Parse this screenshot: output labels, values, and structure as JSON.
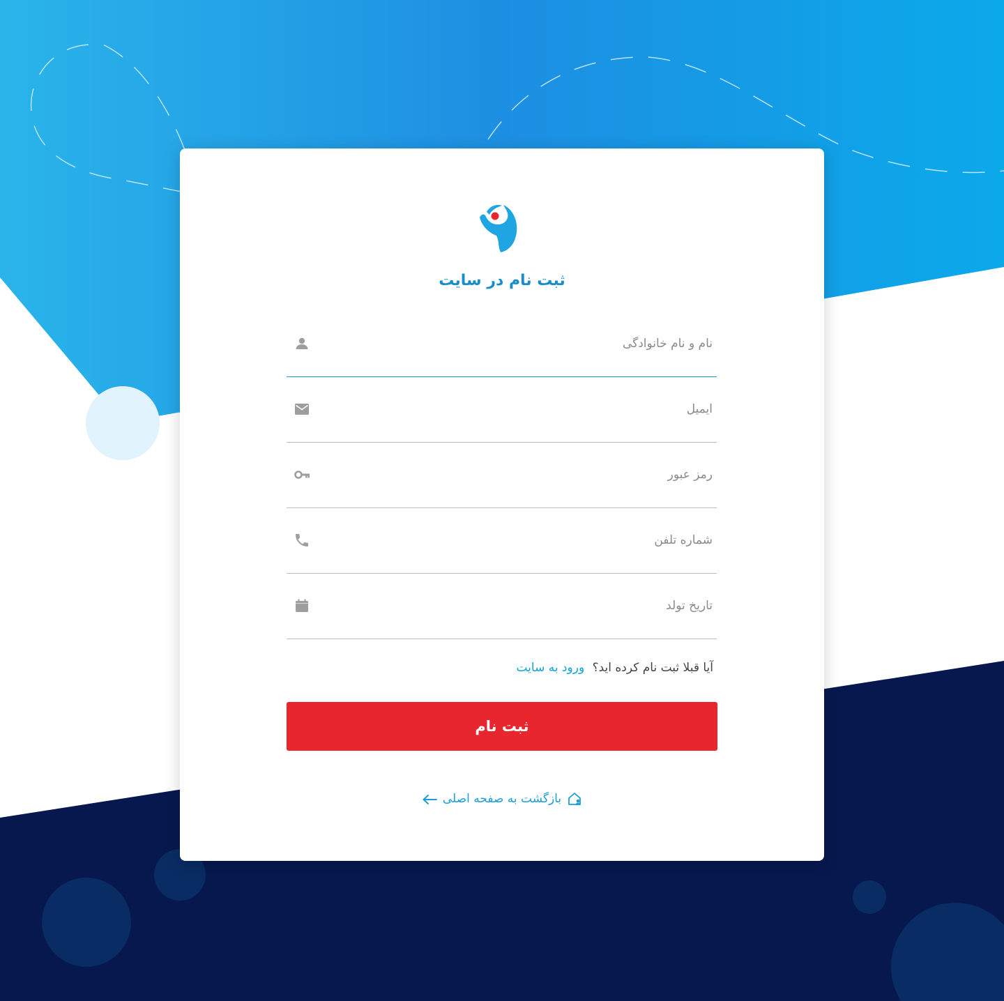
{
  "colors": {
    "sky_top": "#1d95e4",
    "sky_light": "#2ab4ea",
    "navy": "#06184d",
    "accent_blue": "#1a8cc9",
    "link_blue": "#0ea5d6",
    "submit_red": "#e8262d"
  },
  "logo": {
    "icon": "person-logo-icon"
  },
  "form": {
    "title": "ثبت نام در سایت",
    "fields": [
      {
        "placeholder": "نام و نام خانوادگی",
        "icon": "person-icon",
        "value": ""
      },
      {
        "placeholder": "ایمیل",
        "icon": "mail-icon",
        "value": ""
      },
      {
        "placeholder": "رمز عبور",
        "icon": "key-icon",
        "value": ""
      },
      {
        "placeholder": "شماره تلفن",
        "icon": "phone-icon",
        "value": ""
      },
      {
        "placeholder": "تاریخ تولد",
        "icon": "calendar-icon",
        "value": ""
      }
    ],
    "already_registered": "آیا قبلا ثبت نام کرده اید؟",
    "login_link": "ورود به سایت",
    "submit_label": "ثبت نام",
    "back_label": "بازگشت به صفحه اصلی"
  }
}
